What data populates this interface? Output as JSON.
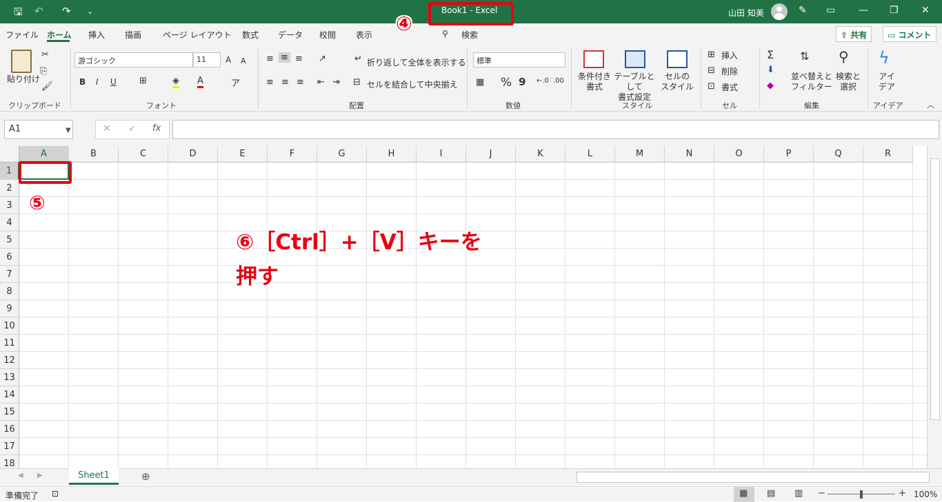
{
  "window": {
    "title": "Book1  -  Excel",
    "user": "山田 知美"
  },
  "menu": {
    "tabs": [
      "ファイル",
      "ホーム",
      "挿入",
      "描画",
      "ページ レイアウト",
      "数式",
      "データ",
      "校閲",
      "表示"
    ],
    "search": "検索",
    "share": "共有",
    "comment": "コメント"
  },
  "ribbon": {
    "clipboard": {
      "paste": "貼り付け",
      "label": "クリップボード"
    },
    "font": {
      "name": "游ゴシック",
      "size": "11",
      "bold": "B",
      "italic": "I",
      "underline": "U",
      "grow": "A",
      "shrink": "A",
      "label": "フォント"
    },
    "alignment": {
      "wrap": "折り返して全体を表示する",
      "merge": "セルを結合して中央揃え",
      "label": "配置"
    },
    "number": {
      "format": "標準",
      "percent": "%",
      "comma": "9",
      "label": "数値"
    },
    "styles": {
      "conditional": [
        "条件付き",
        "書式"
      ],
      "table": [
        "テーブルとして",
        "書式設定"
      ],
      "cell": [
        "セルの",
        "スタイル"
      ],
      "label": "スタイル"
    },
    "cells": {
      "insert": "挿入",
      "delete": "削除",
      "format": "書式",
      "label": "セル"
    },
    "editing": {
      "sort": [
        "並べ替えと",
        "フィルター"
      ],
      "find": [
        "検索と",
        "選択"
      ],
      "label": "編集"
    },
    "ideas": {
      "btn": [
        "アイ",
        "デア"
      ],
      "label": "アイデア"
    }
  },
  "formula_bar": {
    "name_box": "A1",
    "fx": "fx",
    "value": ""
  },
  "grid": {
    "columns": [
      "A",
      "B",
      "C",
      "D",
      "E",
      "F",
      "G",
      "H",
      "I",
      "J",
      "K",
      "L",
      "M",
      "N",
      "O",
      "P",
      "Q",
      "R"
    ],
    "rows": [
      "1",
      "2",
      "3",
      "4",
      "5",
      "6",
      "7",
      "8",
      "9",
      "10",
      "11",
      "12",
      "13",
      "14",
      "15",
      "16",
      "17",
      "18"
    ],
    "selected_cell": "A1"
  },
  "sheets": {
    "tabs": [
      "Sheet1"
    ]
  },
  "status": {
    "ready": "準備完了",
    "zoom": "100%"
  },
  "annotations": {
    "step4": "④",
    "step5": "⑤",
    "step6_line1": "⑥［Ctrl］+［V］キーを",
    "step6_line2": "押す"
  },
  "colors": {
    "accent": "#217346",
    "annotation": "#e60012"
  }
}
